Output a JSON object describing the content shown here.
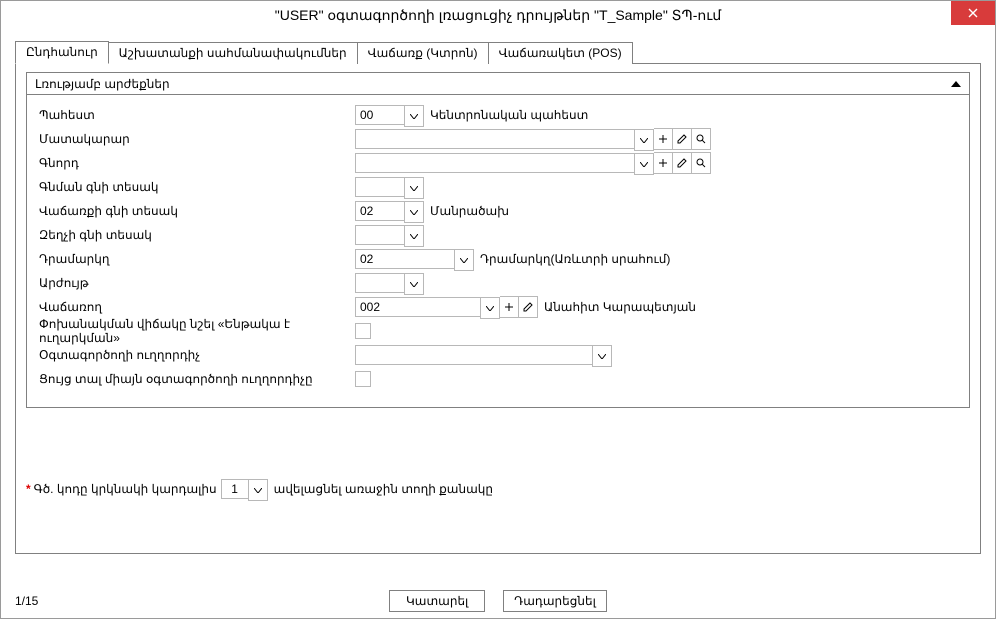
{
  "window": {
    "title": "\"USER\" օգտագործողի լռացուցիչ դրույթներ \"T_Sample\" ՏՊ-ում"
  },
  "tabs": {
    "t0": "Ընդհանուր",
    "t1": "Աշխատանքի սահմանափակումներ",
    "t2": "Վաճառք (Կտրոն)",
    "t3": "Վաճառակետ (POS)"
  },
  "group": {
    "title": "Լռությամբ արժեքներ"
  },
  "labels": {
    "warehouse": "Պահեստ",
    "supplier": "Մատակարար",
    "buyer": "Գնորդ",
    "purchasePriceType": "Գնման գնի տեսակ",
    "salePriceType": "Վաճառքի գնի տեսակ",
    "discPriceType": "Զեղչի գնի տեսակ",
    "cashbox": "Դրամարկղ",
    "currency": "Արժույթ",
    "seller": "Վաճառող",
    "transferState": "Փոխանակման վիճակը նշել «Ենթակա է ուղարկման»",
    "userGuide": "Օգտագործողի ուղղորդիչ",
    "showOnlyUserGuide": "Ցույց տալ միայն օգտագործողի ուղղորդիչը"
  },
  "values": {
    "warehouse": "00",
    "warehouseDesc": "Կենտրոնական պահեստ",
    "supplier": "",
    "buyer": "",
    "purchasePriceType": "",
    "salePriceType": "02",
    "salePriceTypeDesc": "Մանրածախ",
    "discPriceType": "",
    "cashbox": "02",
    "cashboxDesc": "Դրամարկղ(Առևտրի սրահում)",
    "currency": "",
    "seller": "002",
    "sellerDesc": "Անահիտ Կարապետյան",
    "userGuide": ""
  },
  "footnote": {
    "prefix": "Գծ. կոդը կրկնակի կարդալիս",
    "value": "1",
    "suffix": "ավելացնել առաջին տողի քանակը"
  },
  "pager": "1/15",
  "buttons": {
    "ok": "Կատարել",
    "cancel": "Դադարեցնել"
  }
}
